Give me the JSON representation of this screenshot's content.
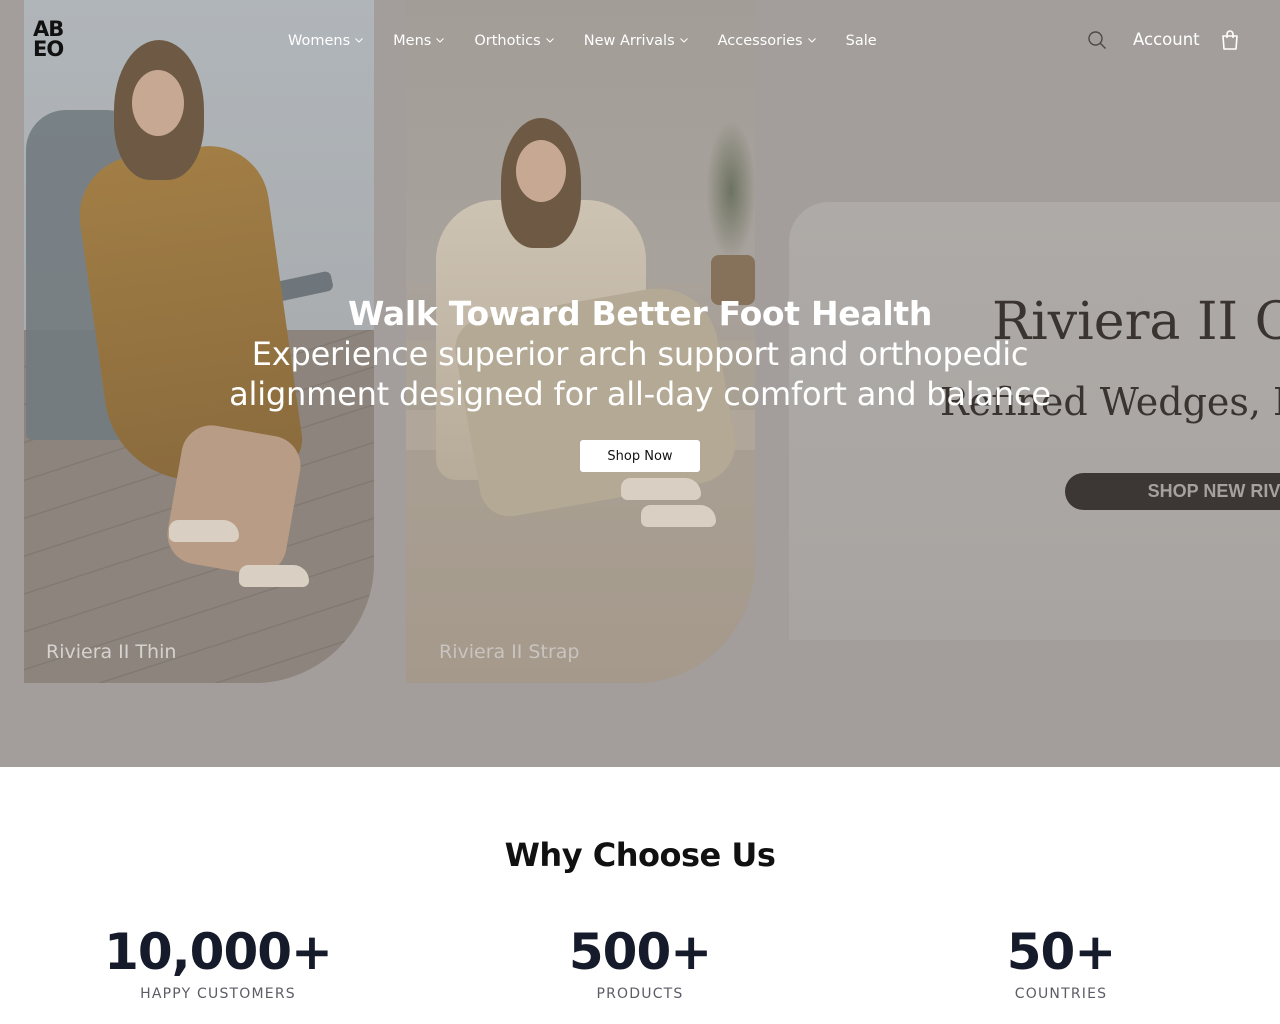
{
  "header": {
    "logo_line1": "AB",
    "logo_line2": "EO",
    "nav": [
      {
        "label": "Womens",
        "has_dropdown": true
      },
      {
        "label": "Mens",
        "has_dropdown": true
      },
      {
        "label": "Orthotics",
        "has_dropdown": true
      },
      {
        "label": "New Arrivals",
        "has_dropdown": true
      },
      {
        "label": "Accessories",
        "has_dropdown": true
      },
      {
        "label": "Sale",
        "has_dropdown": false
      }
    ],
    "search_icon": "search-icon",
    "account_label": "Account",
    "cart_icon": "shopping-bag-icon"
  },
  "hero": {
    "cards": [
      {
        "label": "Riviera II Thin"
      },
      {
        "label": "Riviera II Strap"
      }
    ],
    "promo": {
      "title": "Riviera II Col",
      "subtitle": "Refined Wedges, Buil",
      "button_label": "SHOP NEW RIVIE"
    },
    "title": "Walk Toward Better Foot Health",
    "subtitle": "Experience superior arch support and orthopedic alignment designed for all-day comfort and balance",
    "cta_label": "Shop Now",
    "overlay_color": "#a39e9b"
  },
  "why": {
    "title": "Why Choose Us",
    "stats": [
      {
        "value": "10,000+",
        "label": "HAPPY CUSTOMERS"
      },
      {
        "value": "500+",
        "label": "PRODUCTS"
      },
      {
        "value": "50+",
        "label": "COUNTRIES"
      }
    ]
  }
}
